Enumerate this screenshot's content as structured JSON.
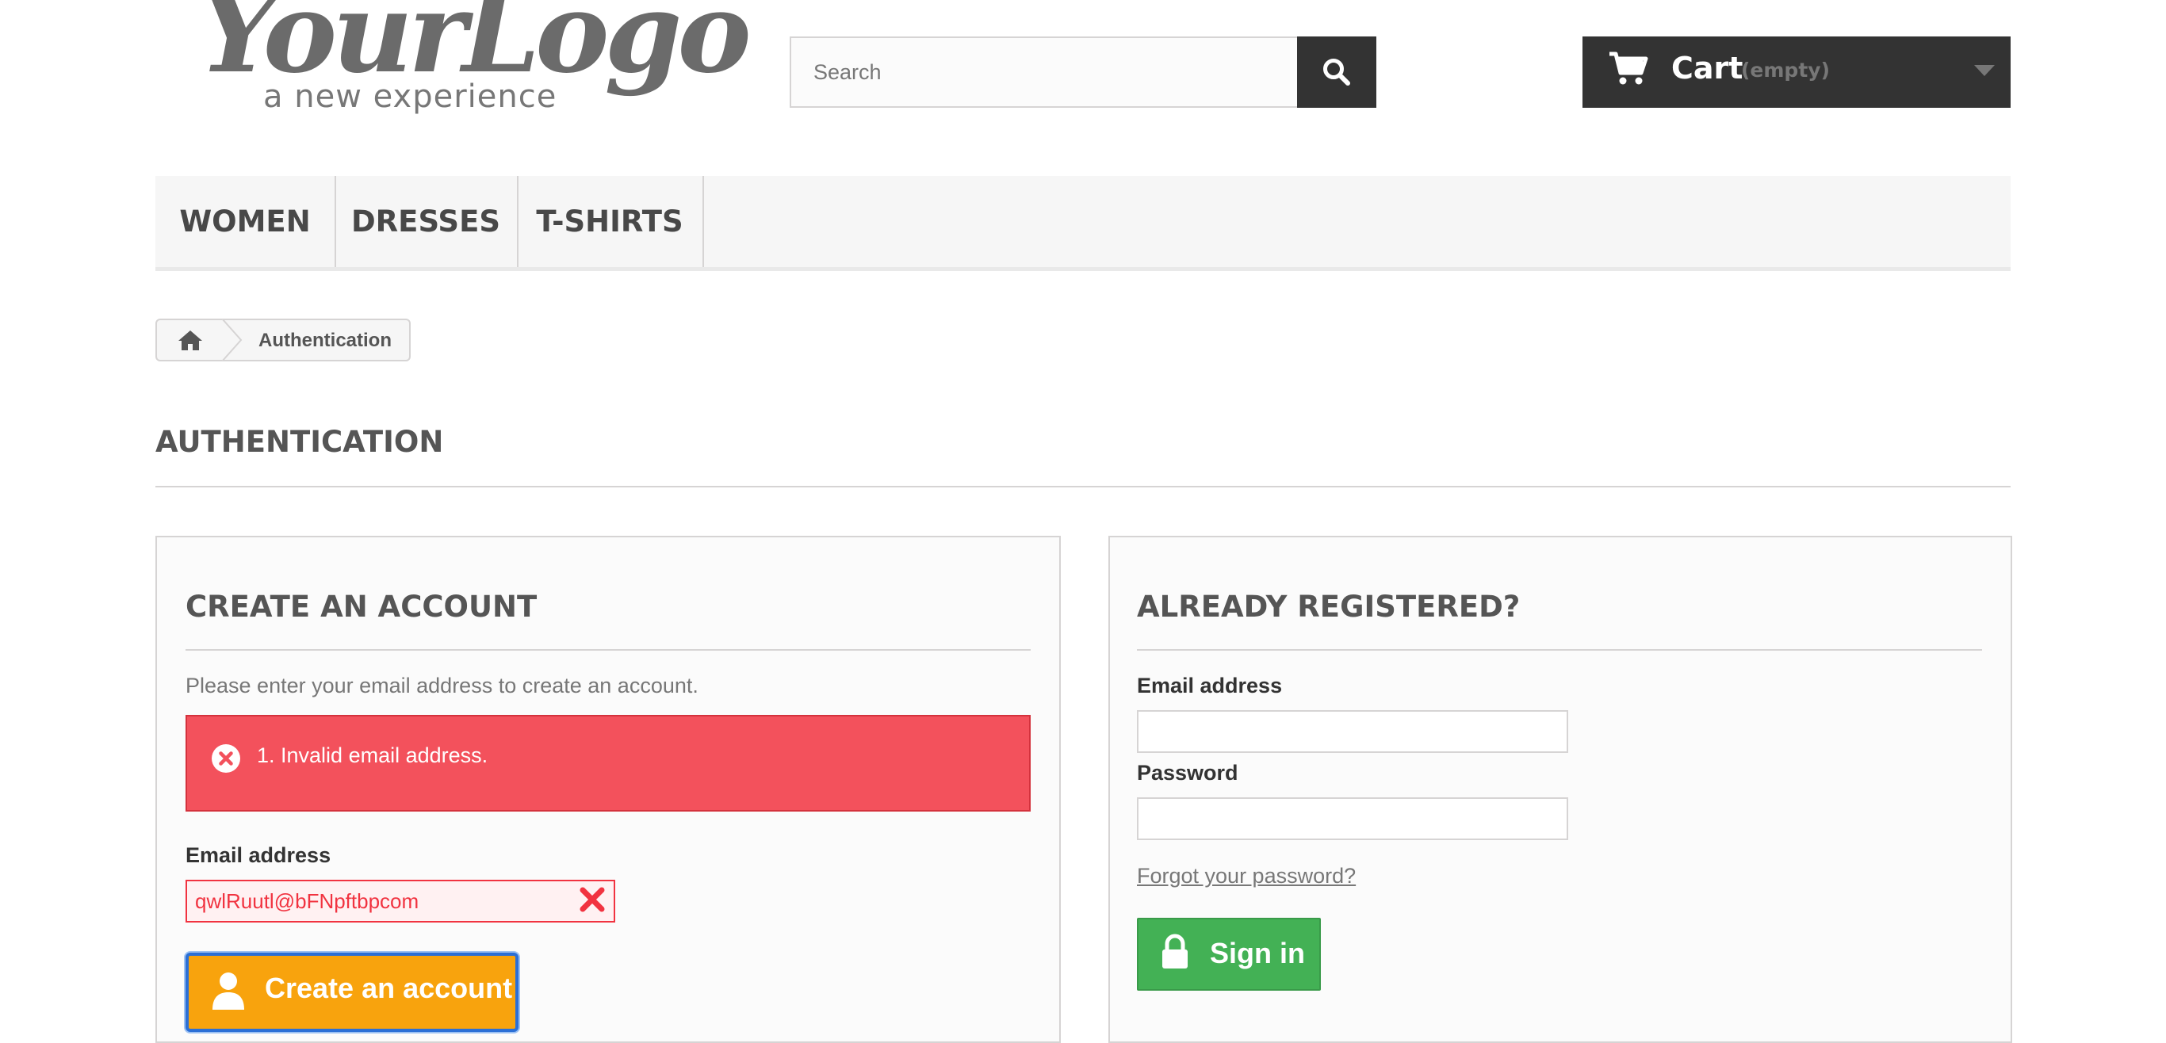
{
  "logo": {
    "main": "YourLogo",
    "tagline": "a new experience"
  },
  "search": {
    "placeholder": "Search",
    "icon": "search-icon"
  },
  "cart": {
    "label": "Cart",
    "quantity": "(empty)",
    "icon": "shopping-cart-icon"
  },
  "menu": {
    "items": [
      {
        "label": "WOMEN"
      },
      {
        "label": "DRESSES"
      },
      {
        "label": "T-SHIRTS"
      }
    ]
  },
  "breadcrumb": {
    "home_icon": "home-icon",
    "current": "Authentication"
  },
  "page": {
    "title": "AUTHENTICATION"
  },
  "create_account": {
    "title": "CREATE AN ACCOUNT",
    "instructions": "Please enter your email address to create an account.",
    "error_message": "1. Invalid email address.",
    "email_label": "Email address",
    "email_value": "qwlRuutl@bFNpftbpcom",
    "button_label": "Create an account",
    "error_color": "#f3515c",
    "button_color": "#f8a30d"
  },
  "already_registered": {
    "title": "ALREADY REGISTERED?",
    "email_label": "Email address",
    "email_value": "",
    "password_label": "Password",
    "password_value": "",
    "forgot_link": "Forgot your password?",
    "button_label": "Sign in",
    "button_color": "#43b155"
  }
}
